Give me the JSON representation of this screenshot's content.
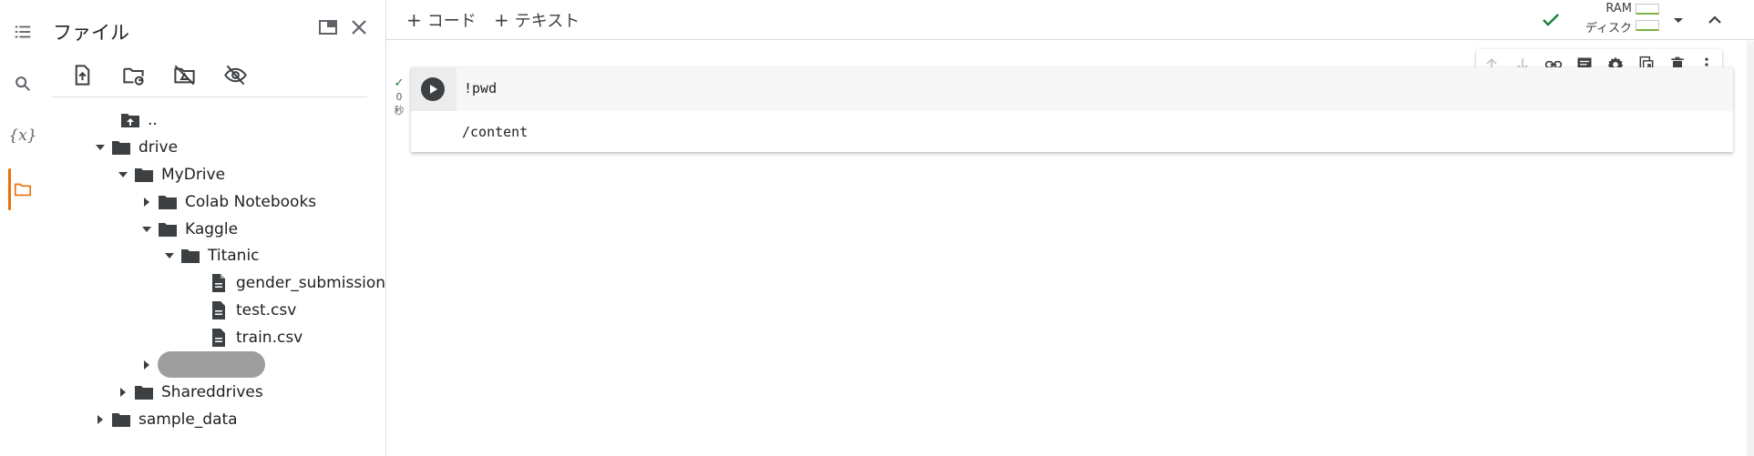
{
  "file_panel": {
    "title": "ファイル",
    "tree": [
      {
        "label": "..",
        "depth": 0,
        "type": "parent"
      },
      {
        "label": "drive",
        "depth": 0,
        "type": "folder",
        "expanded": true
      },
      {
        "label": "MyDrive",
        "depth": 1,
        "type": "folder",
        "expanded": true
      },
      {
        "label": "Colab Notebooks",
        "depth": 2,
        "type": "folder",
        "expanded": false
      },
      {
        "label": "Kaggle",
        "depth": 2,
        "type": "folder",
        "expanded": true
      },
      {
        "label": "Titanic",
        "depth": 3,
        "type": "folder",
        "expanded": true
      },
      {
        "label": "gender_submission.c...",
        "depth": 4,
        "type": "file"
      },
      {
        "label": "test.csv",
        "depth": 4,
        "type": "file"
      },
      {
        "label": "train.csv",
        "depth": 4,
        "type": "file"
      },
      {
        "label": "Shareddrives",
        "depth": 1,
        "type": "folder",
        "expanded": false
      },
      {
        "label": "sample_data",
        "depth": 0,
        "type": "folder",
        "expanded": false
      }
    ]
  },
  "topbar": {
    "add_code_label": "コード",
    "add_text_label": "テキスト",
    "ram_label": "RAM",
    "disk_label": "ディスク"
  },
  "cell": {
    "code": "!pwd",
    "output": "/content",
    "exec_count": "0",
    "exec_unit": "秒"
  },
  "colors": {
    "accent_orange": "#e8710a",
    "success_green": "#188038"
  }
}
